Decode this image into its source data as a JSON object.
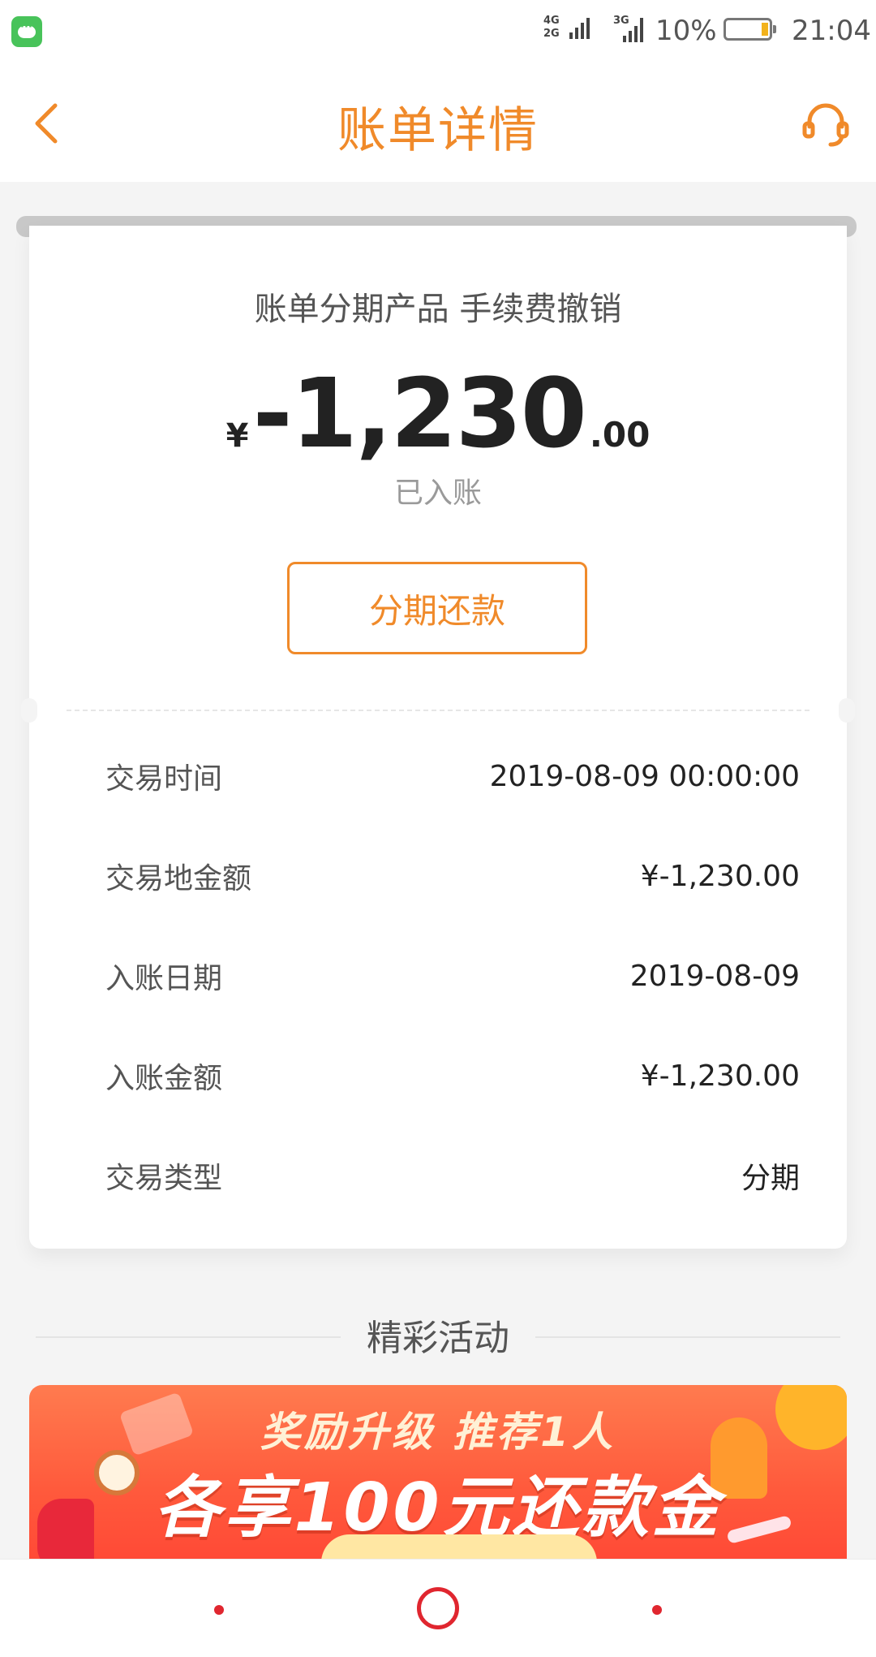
{
  "status_bar": {
    "network_top": "4G",
    "network_bottom": "2G",
    "network_3g": "3G",
    "battery_text": "10%",
    "time": "21:04"
  },
  "header": {
    "title": "账单详情",
    "back_icon": "chevron-left-icon",
    "service_icon": "headset-icon"
  },
  "bill": {
    "subtitle": "账单分期产品 手续费撤销",
    "currency_symbol": "¥",
    "amount_main": "-1,230",
    "amount_decimal": ".00",
    "status": "已入账",
    "installment_button": "分期还款"
  },
  "details": [
    {
      "label": "交易时间",
      "value": "2019-08-09 00:00:00"
    },
    {
      "label": "交易地金额",
      "value": "¥-1,230.00"
    },
    {
      "label": "入账日期",
      "value": "2019-08-09"
    },
    {
      "label": "入账金额",
      "value": "¥-1,230.00"
    },
    {
      "label": "交易类型",
      "value": "分期"
    }
  ],
  "activities": {
    "section_title": "精彩活动",
    "banner_line1": "奖励升级 推荐1人",
    "banner_line2": "各享100元还款金"
  },
  "colors": {
    "accent": "#f08a2a",
    "nav_red": "#e0262f",
    "banner": "#ff5a3c"
  }
}
